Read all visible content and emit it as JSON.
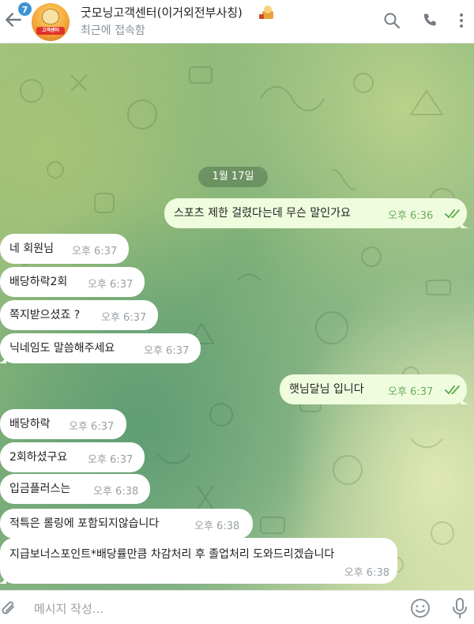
{
  "header": {
    "unread_count": "7",
    "avatar_label": "고객센터",
    "title": "굿모닝고객센터(이거외전부사칭)",
    "status": "최근에 접속함"
  },
  "chat": {
    "date": "1월 17일",
    "messages": [
      {
        "dir": "out",
        "text": "스포츠 제한 걸렸다는데 무슨 말인가요",
        "time": "오후 6:36"
      },
      {
        "dir": "in",
        "text": "네 회원님",
        "time": "오후 6:37"
      },
      {
        "dir": "in",
        "text": "배당하락2회",
        "time": "오후 6:37"
      },
      {
        "dir": "in",
        "text": "쪽지받으셨죠 ?",
        "time": "오후 6:37"
      },
      {
        "dir": "in",
        "text": "닉네임도 말씀해주세요",
        "time": "오후 6:37"
      },
      {
        "dir": "out",
        "text": "햇님달님 입니다",
        "time": "오후 6:37"
      },
      {
        "dir": "in",
        "text": "배당하락",
        "time": "오후 6:37"
      },
      {
        "dir": "in",
        "text": "2회하셨구요",
        "time": "오후 6:37"
      },
      {
        "dir": "in",
        "text": "입금플러스는",
        "time": "오후 6:38"
      },
      {
        "dir": "in",
        "text": "적특은 롤링에 포함되지않습니다",
        "time": "오후 6:38"
      },
      {
        "dir": "in",
        "text": "지급보너스포인트*배당률만큼 차감처리 후 졸업처리 도와드리겠습니다",
        "time": "오후 6:38"
      }
    ]
  },
  "composer": {
    "placeholder": "메시지 작성..."
  },
  "icons": {
    "back": "back-arrow-icon",
    "search": "search-icon",
    "call": "phone-icon",
    "menu": "more-vertical-icon",
    "attach": "paperclip-icon",
    "emoji": "smile-icon",
    "mic": "microphone-icon",
    "read": "double-check-icon"
  },
  "colors": {
    "incoming_bubble": "#ffffff",
    "outgoing_bubble": "#effdde",
    "read_check": "#5aa64e",
    "unread_badge": "#3b93d4"
  }
}
